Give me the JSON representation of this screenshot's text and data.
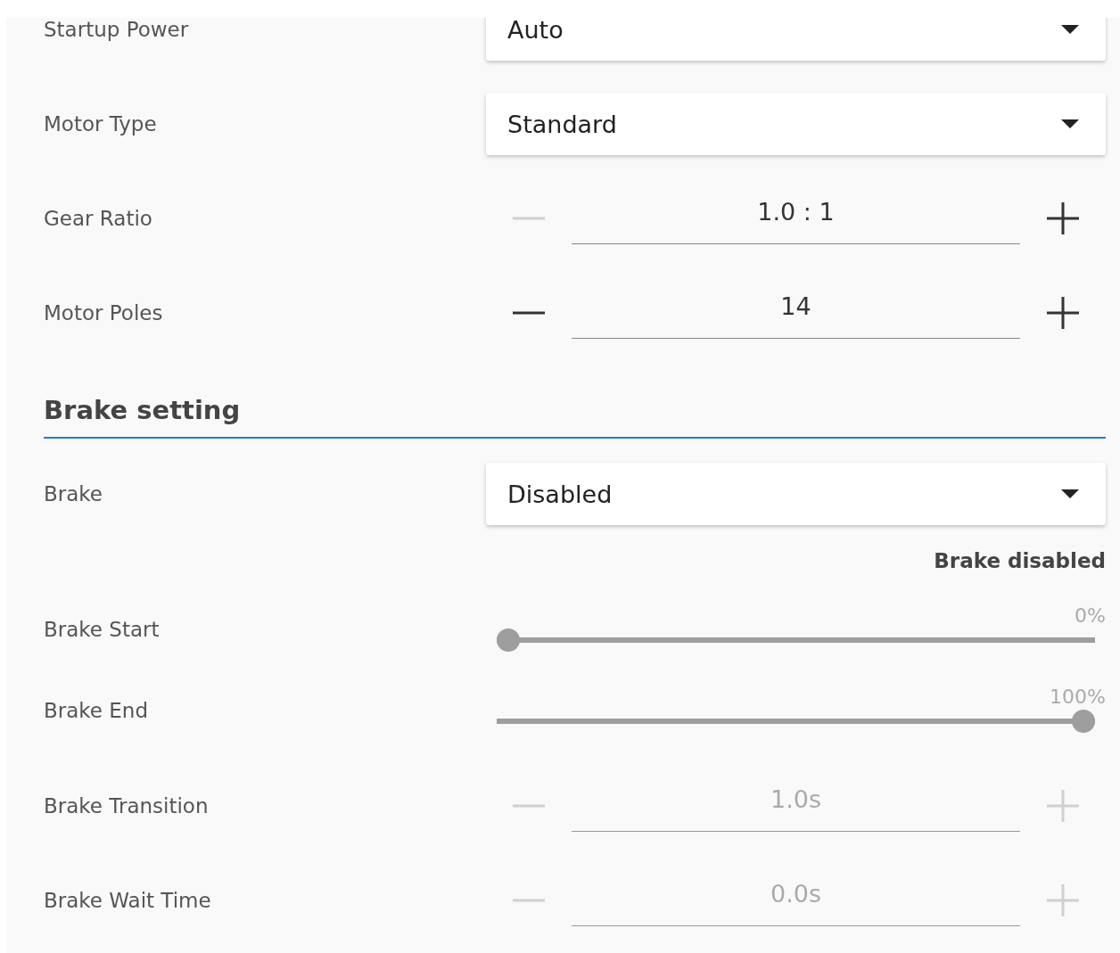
{
  "motor_rows": [
    {
      "kind": "select",
      "label": "Startup Power",
      "value": "Auto"
    },
    {
      "kind": "select",
      "label": "Motor Type",
      "value": "Standard"
    },
    {
      "kind": "stepper",
      "label": "Gear Ratio",
      "value": "1.0 : 1",
      "disabled": false,
      "minus_disabled": true,
      "plus_disabled": false
    },
    {
      "kind": "stepper",
      "label": "Motor Poles",
      "value": "14",
      "disabled": false,
      "minus_disabled": false,
      "plus_disabled": false
    }
  ],
  "brake_section": {
    "title": "Brake setting",
    "rows": [
      {
        "kind": "select",
        "label": "Brake",
        "value": "Disabled"
      },
      {
        "kind": "note",
        "text": "Brake disabled"
      },
      {
        "kind": "slider",
        "label": "Brake Start",
        "reading": "0%",
        "level": 0,
        "disabled": true
      },
      {
        "kind": "slider",
        "label": "Brake End",
        "reading": "100%",
        "level": 1,
        "disabled": true
      },
      {
        "kind": "stepper",
        "label": "Brake Transition",
        "value": "1.0s",
        "disabled": true,
        "minus_disabled": true,
        "plus_disabled": true
      },
      {
        "kind": "stepper",
        "label": "Brake Wait Time",
        "value": "0.0s",
        "disabled": true,
        "minus_disabled": true,
        "plus_disabled": true
      }
    ]
  }
}
